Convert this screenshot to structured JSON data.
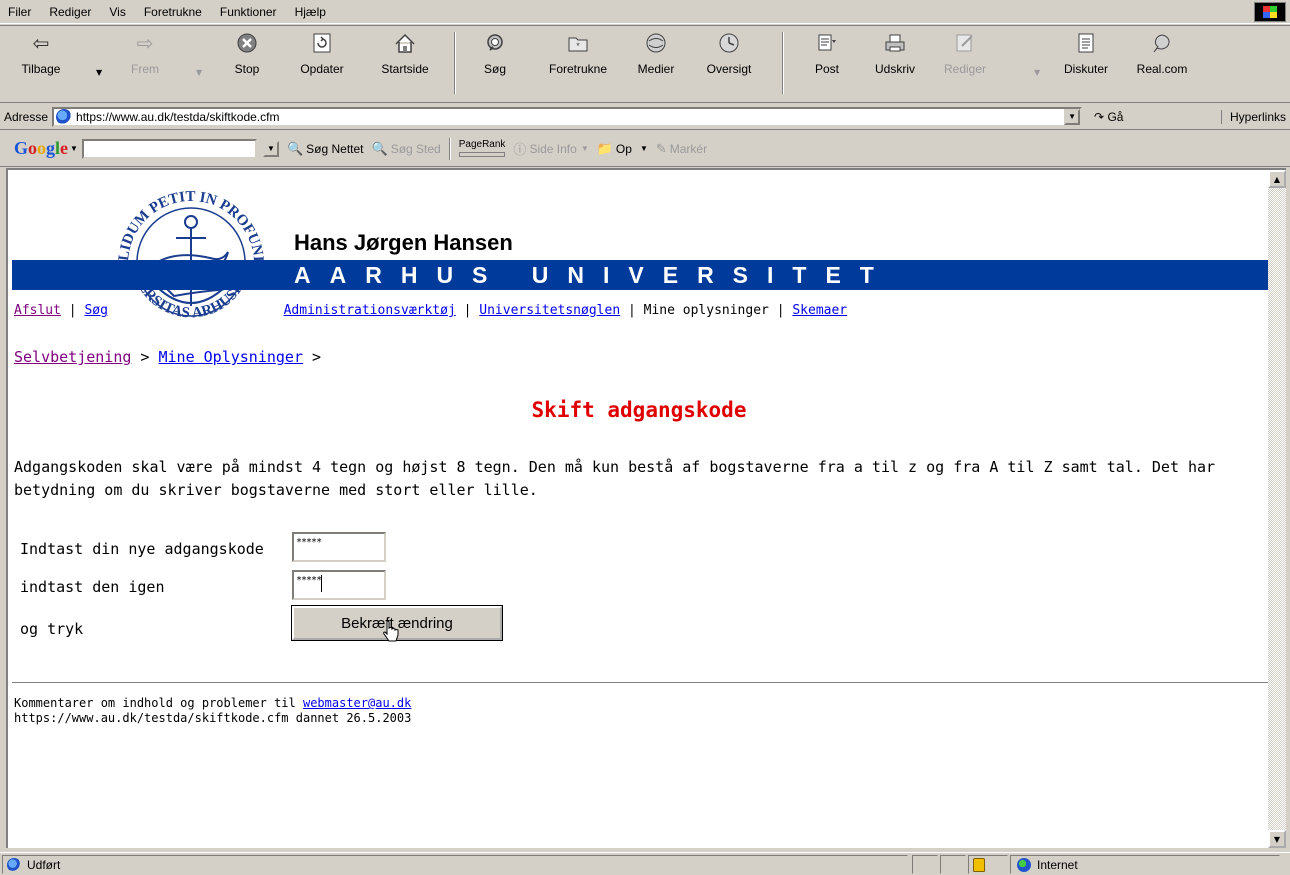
{
  "menu": [
    "Filer",
    "Rediger",
    "Vis",
    "Foretrukne",
    "Funktioner",
    "Hjælp"
  ],
  "toolbar": {
    "back": "Tilbage",
    "forward": "Frem",
    "stop": "Stop",
    "refresh": "Opdater",
    "home": "Startside",
    "search": "Søg",
    "favorites": "Foretrukne",
    "media": "Medier",
    "history": "Oversigt",
    "mail": "Post",
    "print": "Udskriv",
    "edit": "Rediger",
    "discuss": "Diskuter",
    "real": "Real.com"
  },
  "address": {
    "label": "Adresse",
    "url": "https://www.au.dk/testda/skiftkode.cfm",
    "go": "Gå",
    "links": "Hyperlinks"
  },
  "googlebar": {
    "logo_parts": [
      "G",
      "o",
      "o",
      "g",
      "l",
      "e"
    ],
    "search_web": "Søg Nettet",
    "search_site": "Søg Sted",
    "pagerank": "PageRank",
    "page_info": "Side Info",
    "up": "Op",
    "highlight": "Markér"
  },
  "header": {
    "owner_name": "Hans Jørgen Hansen",
    "university": "AARHUS UNIVERSITET",
    "seal_text_top": "SOLIDUM PETIT IN PROFUNDIS",
    "seal_text_bottom": "UNIVERSITAS ARHUSIENSIS"
  },
  "nav": {
    "logout": "Afslut",
    "sep1": " | ",
    "search": "Søg",
    "admin": "Administrationsværktøj",
    "sep2": " | ",
    "key": "Universitetsnøglen",
    "my_info": " | Mine oplysninger  | ",
    "forms": "Skemaer"
  },
  "breadcrumb": {
    "home": "Selvbetjening",
    "sep1": " > ",
    "mine": "Mine Oplysninger",
    "sep2": " >"
  },
  "content": {
    "title": "Skift adgangskode",
    "intro_line1": "Adgangskoden skal være på mindst 4 tegn og højst 8 tegn. Den må kun bestå af bogstaverne fra a til z og fra A til Z samt tal. Det har",
    "intro_line2": "betydning om du skriver bogstaverne med stort eller lille.",
    "label_new": "Indtast din nye adgangskode",
    "label_again": "indtast den igen",
    "label_press": "og tryk",
    "new_value": "*****",
    "again_value": "*****",
    "submit": "Bekræft ændring"
  },
  "footer": {
    "line1": "Kommentarer om indhold og problemer til ",
    "email": "webmaster@au.dk",
    "line2": "https://www.au.dk/testda/skiftkode.cfm dannet 26.5.2003"
  },
  "status": {
    "text": "Udført",
    "zone": "Internet"
  }
}
